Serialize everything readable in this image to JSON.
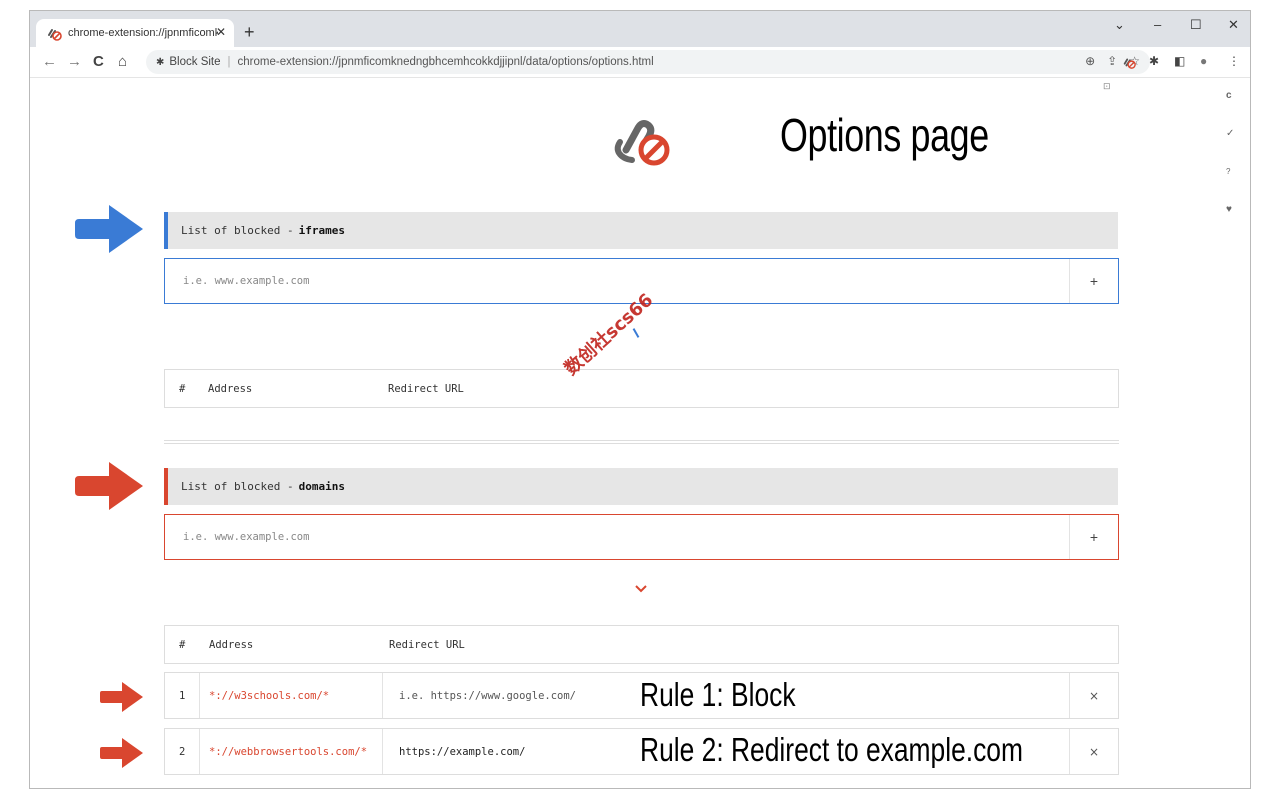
{
  "browser": {
    "tab_title": "chrome-extension://jpnmficomk",
    "tab_close": "✕",
    "new_tab": "+",
    "win_min": "–",
    "win_max": "☐",
    "win_close": "✕",
    "win_menu": "⌄",
    "site_chip": "Block Site",
    "url": "chrome-extension://jpnmficomknedngbhcemhcokkdjjipnl/data/options/options.html"
  },
  "icons": {
    "back": "←",
    "forward": "→",
    "reload": "C",
    "home": "⌂",
    "zoom": "⊕",
    "share": "⇪",
    "star": "☆",
    "puzzle": "✱",
    "sidepanel": "◧",
    "profile": "●",
    "menu": "⋮"
  },
  "side_icons": [
    "c",
    "✓",
    "?",
    "♥"
  ],
  "header": {
    "title": "Options page"
  },
  "iframes_section": {
    "label_prefix": "List of blocked -",
    "label_strong": "iframes",
    "placeholder": "i.e. www.example.com",
    "add": "+",
    "table": {
      "col_num": "#",
      "col_address": "Address",
      "col_redirect": "Redirect URL"
    },
    "accent": "#3a7bd5"
  },
  "domains_section": {
    "label_prefix": "List of blocked -",
    "label_strong": "domains",
    "placeholder": "i.e. www.example.com",
    "add": "+",
    "table": {
      "col_num": "#",
      "col_address": "Address",
      "col_redirect": "Redirect URL"
    },
    "accent": "#d9462f",
    "rules": [
      {
        "num": "1",
        "address": "*://w3schools.com/*",
        "redirect": "i.e. https://www.google.com/",
        "delete": "×"
      },
      {
        "num": "2",
        "address": "*://webbrowsertools.com/*",
        "redirect": "https://example.com/",
        "delete": "×"
      }
    ]
  },
  "annotations": {
    "rule1": "Rule 1: Block",
    "rule2": "Rule 2: Redirect to example.com"
  },
  "watermark": "数创社scs66"
}
